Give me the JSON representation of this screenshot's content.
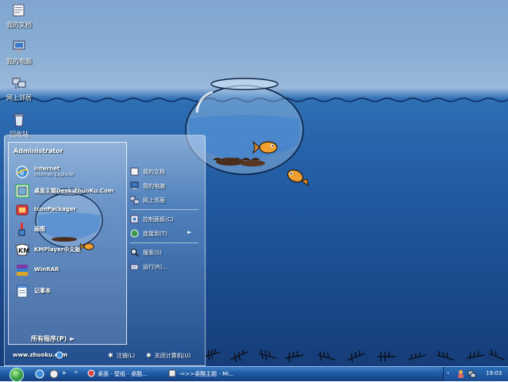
{
  "desktop": {
    "icons": [
      {
        "label": "我的文档",
        "icon": "my-documents-icon"
      },
      {
        "label": "我的电脑",
        "icon": "my-computer-icon"
      },
      {
        "label": "网上邻居",
        "icon": "network-places-icon"
      },
      {
        "label": "回收站",
        "icon": "recycle-bin-icon"
      }
    ]
  },
  "start_menu": {
    "user_name": "Administrator",
    "programs": [
      {
        "title": "Internet",
        "subtitle": "Internet Explorer",
        "icon": "internet-explorer-icon"
      },
      {
        "title": "桌面主题Desk.ZhuoKu.Com",
        "icon": "theme-icon"
      },
      {
        "title": "IconPackager",
        "icon": "iconpackager-icon"
      },
      {
        "title": "画图",
        "icon": "paint-icon"
      },
      {
        "title": "KMPlayer中文版",
        "icon": "kmplayer-icon"
      },
      {
        "title": "WinRAR",
        "icon": "winrar-icon"
      },
      {
        "title": "记事本",
        "icon": "notepad-icon"
      }
    ],
    "all_programs": "所有程序(P)",
    "places": [
      {
        "label": "我的文档",
        "icon": "my-documents-icon"
      },
      {
        "label": "我的电脑",
        "icon": "my-computer-icon"
      },
      {
        "label": "网上邻居",
        "icon": "network-places-icon"
      },
      {
        "label": "控制面板(C)",
        "icon": "control-panel-icon"
      },
      {
        "label": "连接到(T)",
        "icon": "connect-to-icon",
        "has_submenu": true
      },
      {
        "label": "搜索(S)",
        "icon": "search-icon"
      },
      {
        "label": "运行(R)...",
        "icon": "run-icon"
      }
    ],
    "footer": {
      "site": "www.zhuoku.com",
      "logoff": "注销(L)",
      "shutdown": "关闭计算机(U)"
    }
  },
  "taskbar": {
    "tasks": [
      {
        "label": "桌面 - 壁纸 - 桌酷...",
        "icon": "browser-icon"
      },
      {
        "label": "-=>>桌酷主题 - Mi...",
        "icon": "browser-icon"
      }
    ],
    "clock": "19:03"
  },
  "colors": {
    "sky": "#88aed4",
    "water": "#245fa6",
    "deep_water": "#153d79",
    "taskbar": "#1e5aa6"
  }
}
